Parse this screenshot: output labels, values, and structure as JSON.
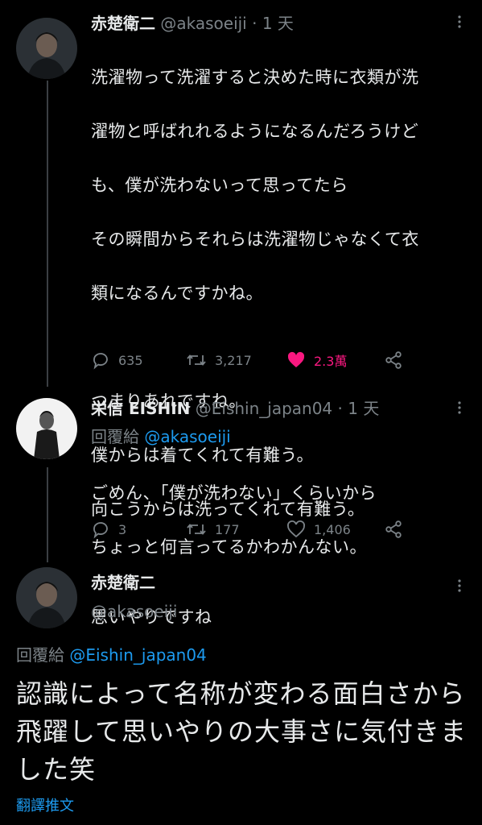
{
  "tweets": [
    {
      "name": "赤楚衛二",
      "handle": "@akasoeiji",
      "dot": "·",
      "time": "1 天",
      "text_lines": [
        "洗濯物って洗濯すると決めた時に衣類が洗",
        "濯物と呼ばれれるようになるんだろうけど",
        "も、僕が洗わないって思ってたら",
        "その瞬間からそれらは洗濯物じゃなくて衣",
        "類になるんですかね。",
        "",
        "つまりあれですね。",
        "僕からは着てくれて有難う。",
        "向こうからは洗ってくれて有難う。",
        "",
        "思いやりですね"
      ],
      "reply_count": "635",
      "retweet_count": "3,217",
      "like_count": "2.3萬",
      "liked": true
    },
    {
      "name": "栄信 EISHIN",
      "handle": "@Eishin_japan04",
      "dot": "·",
      "time": "1 天",
      "reply_prefix": "回覆給",
      "reply_mention": "@akasoeiji",
      "text_lines": [
        "ごめん、「僕が洗わない」くらいから",
        "ちょっと何言ってるかわかんない。"
      ],
      "reply_count": "3",
      "retweet_count": "177",
      "like_count": "1,406",
      "liked": false
    },
    {
      "name": "赤楚衛二",
      "handle": "@akasoeiji",
      "reply_prefix": "回覆給",
      "reply_mention": "@Eishin_japan04",
      "text": "認識によって名称が変わる面白さから飛躍して思いやりの大事さに気付きました笑",
      "translate_label": "翻譯推文"
    }
  ],
  "icons": {
    "more": "more-dots-icon",
    "reply": "reply-icon",
    "retweet": "retweet-icon",
    "like": "heart-icon",
    "share": "share-icon"
  },
  "colors": {
    "background": "#000000",
    "text": "#e7e9ea",
    "secondary": "#7c8388",
    "link": "#1d9bf0",
    "like": "#f91880"
  }
}
